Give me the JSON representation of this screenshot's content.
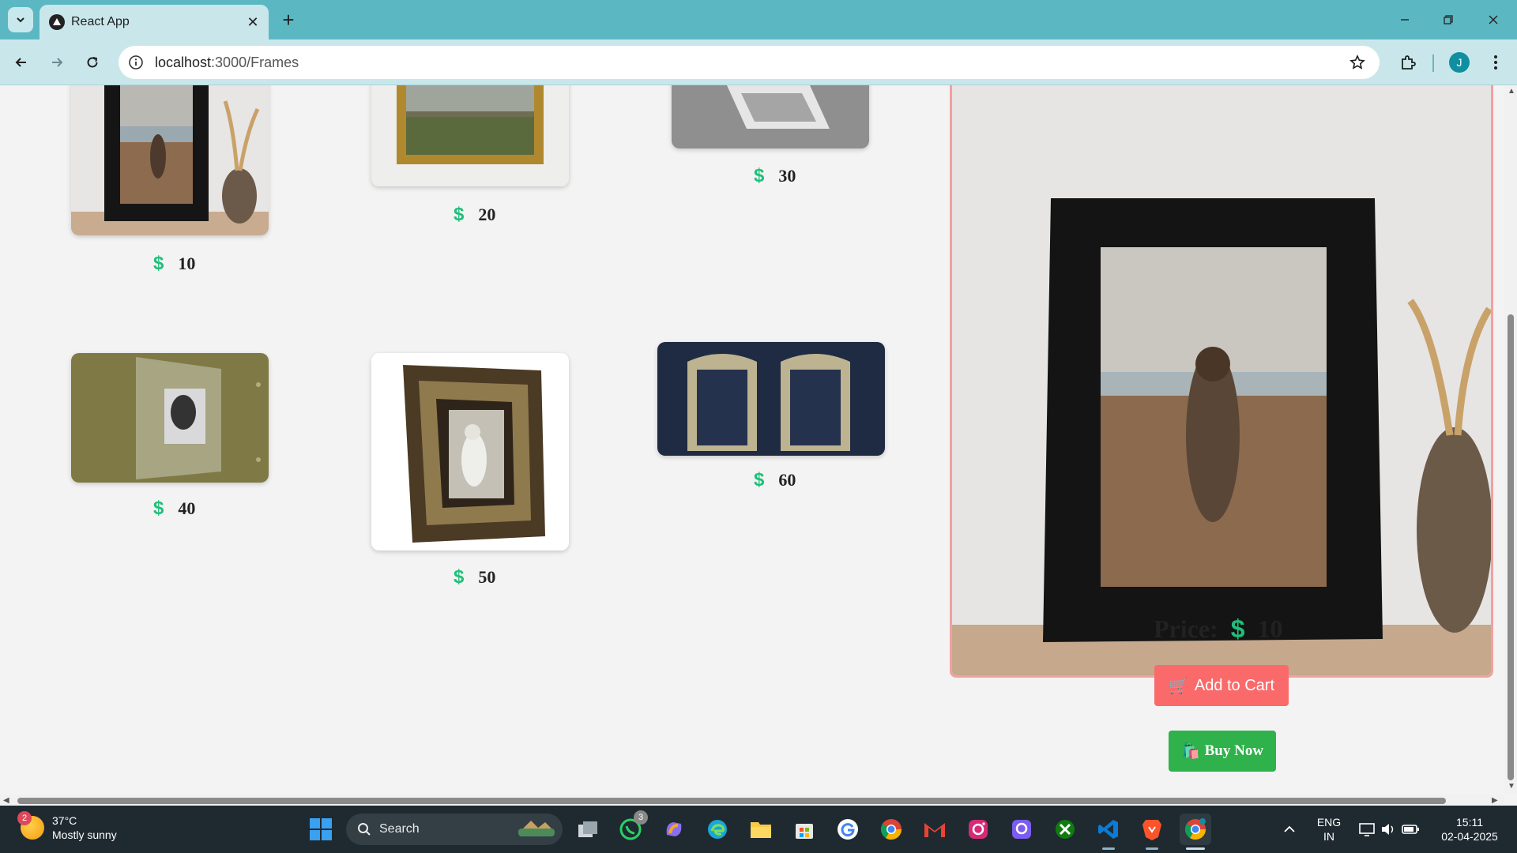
{
  "browser": {
    "tab_title": "React App",
    "url_host": "localhost",
    "url_path": ":3000/Frames",
    "profile_initial": "J"
  },
  "products": [
    {
      "price": "10"
    },
    {
      "price": "20"
    },
    {
      "price": "30"
    },
    {
      "price": "40"
    },
    {
      "price": "50"
    },
    {
      "price": "60"
    }
  ],
  "currency_symbol": "$",
  "detail": {
    "price_label": "Price:",
    "price": "10",
    "add_to_cart_label": "Add to Cart",
    "add_to_cart_icon": "🛒",
    "buy_now_label": "Buy Now",
    "buy_now_icon": "🛍️"
  },
  "taskbar": {
    "weather_badge": "2",
    "temperature": "37°C",
    "weather_desc": "Mostly sunny",
    "search_label": "Search",
    "whatsapp_badge": "3",
    "language_line1": "ENG",
    "language_line2": "IN",
    "time": "15:11",
    "date": "02-04-2025"
  },
  "colors": {
    "accent_green": "#1fbf7a",
    "cart_button": "#fa6a6a",
    "buy_button": "#2fb14b",
    "detail_border": "#f3a0a0",
    "chrome_teal": "#5bb8c3"
  }
}
